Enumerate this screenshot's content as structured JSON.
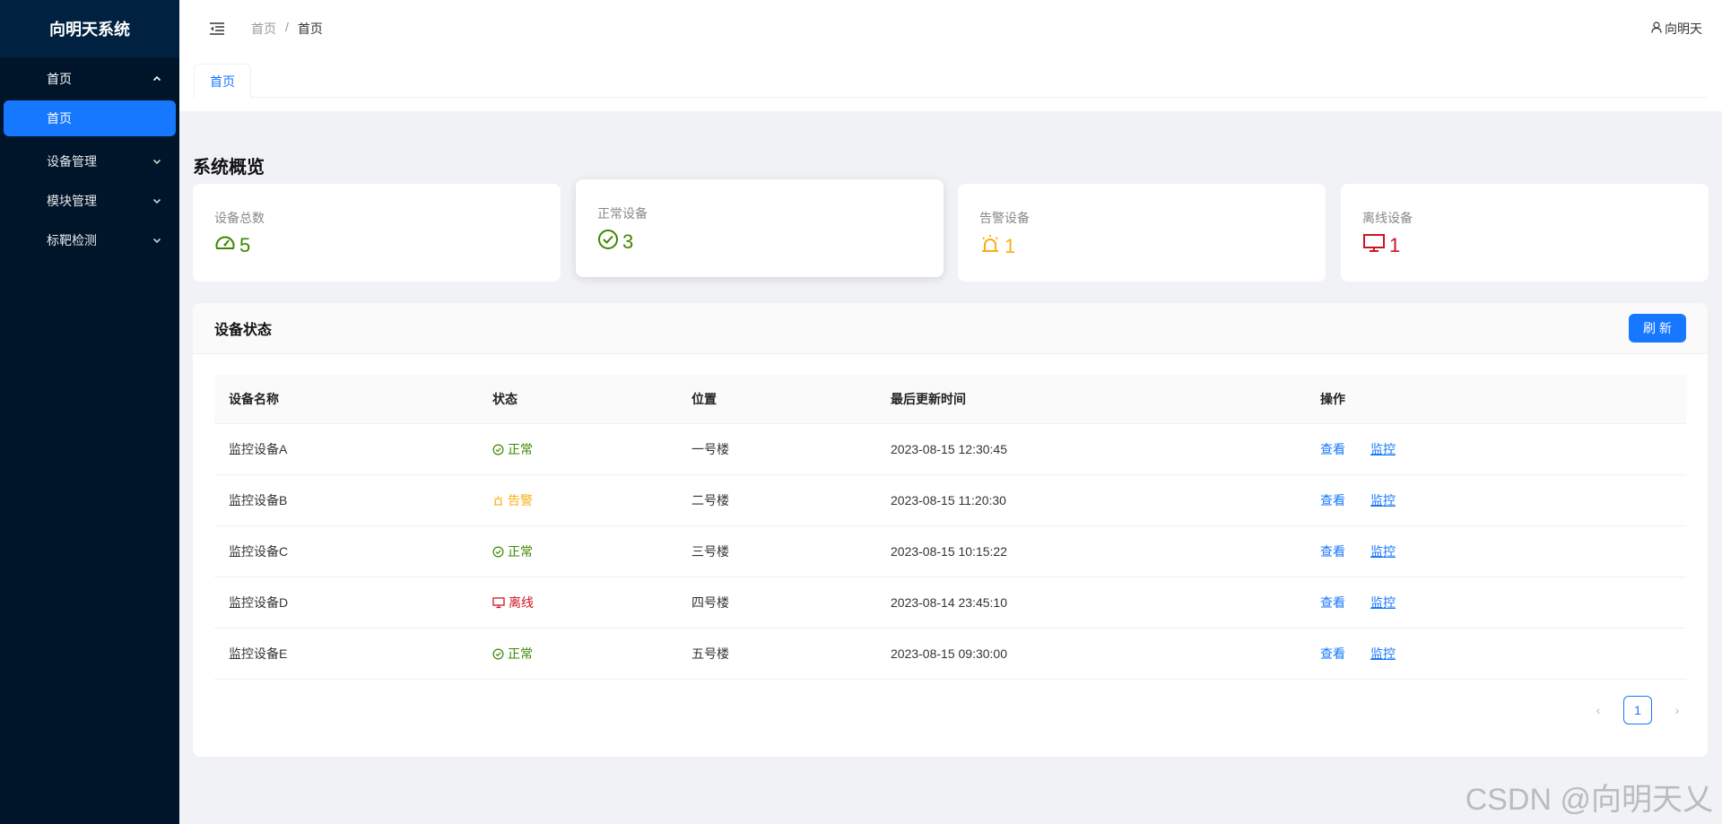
{
  "sidebar": {
    "title": "向明天系统",
    "menu": [
      {
        "label": "首页",
        "expanded": true,
        "children": [
          {
            "label": "首页",
            "active": true
          }
        ]
      },
      {
        "label": "设备管理",
        "expanded": false
      },
      {
        "label": "模块管理",
        "expanded": false
      },
      {
        "label": "标靶检测",
        "expanded": false
      }
    ]
  },
  "header": {
    "breadcrumb": [
      "首页",
      "首页"
    ],
    "breadcrumb_sep": "/",
    "user": "向明天"
  },
  "tabs": [
    {
      "label": "首页",
      "active": true
    }
  ],
  "overview": {
    "title": "系统概览",
    "cards": [
      {
        "label": "设备总数",
        "value": "5",
        "icon": "dashboard-icon",
        "color": "#3f8600"
      },
      {
        "label": "正常设备",
        "value": "3",
        "icon": "check-circle-icon",
        "color": "#3f8600"
      },
      {
        "label": "告警设备",
        "value": "1",
        "icon": "alert-icon",
        "color": "#faad14"
      },
      {
        "label": "离线设备",
        "value": "1",
        "icon": "desktop-icon",
        "color": "#cf1322"
      }
    ]
  },
  "device_status": {
    "title": "设备状态",
    "refresh_label": "刷 新",
    "columns": [
      "设备名称",
      "状态",
      "位置",
      "最后更新时间",
      "操作"
    ],
    "rows": [
      {
        "name": "监控设备A",
        "status": "正常",
        "status_type": "normal",
        "location": "一号楼",
        "updated": "2023-08-15 12:30:45"
      },
      {
        "name": "监控设备B",
        "status": "告警",
        "status_type": "warning",
        "location": "二号楼",
        "updated": "2023-08-15 11:20:30"
      },
      {
        "name": "监控设备C",
        "status": "正常",
        "status_type": "normal",
        "location": "三号楼",
        "updated": "2023-08-15 10:15:22"
      },
      {
        "name": "监控设备D",
        "status": "离线",
        "status_type": "offline",
        "location": "四号楼",
        "updated": "2023-08-14 23:45:10"
      },
      {
        "name": "监控设备E",
        "status": "正常",
        "status_type": "normal",
        "location": "五号楼",
        "updated": "2023-08-15 09:30:00"
      }
    ],
    "actions": [
      "查看",
      "监控"
    ],
    "pagination": {
      "current": "1"
    }
  },
  "colors": {
    "primary": "#1677ff",
    "normal": "#3f8600",
    "warning": "#faad14",
    "offline": "#cf1322",
    "sidebar_bg": "#001529"
  },
  "watermark": "CSDN @向明天乂"
}
